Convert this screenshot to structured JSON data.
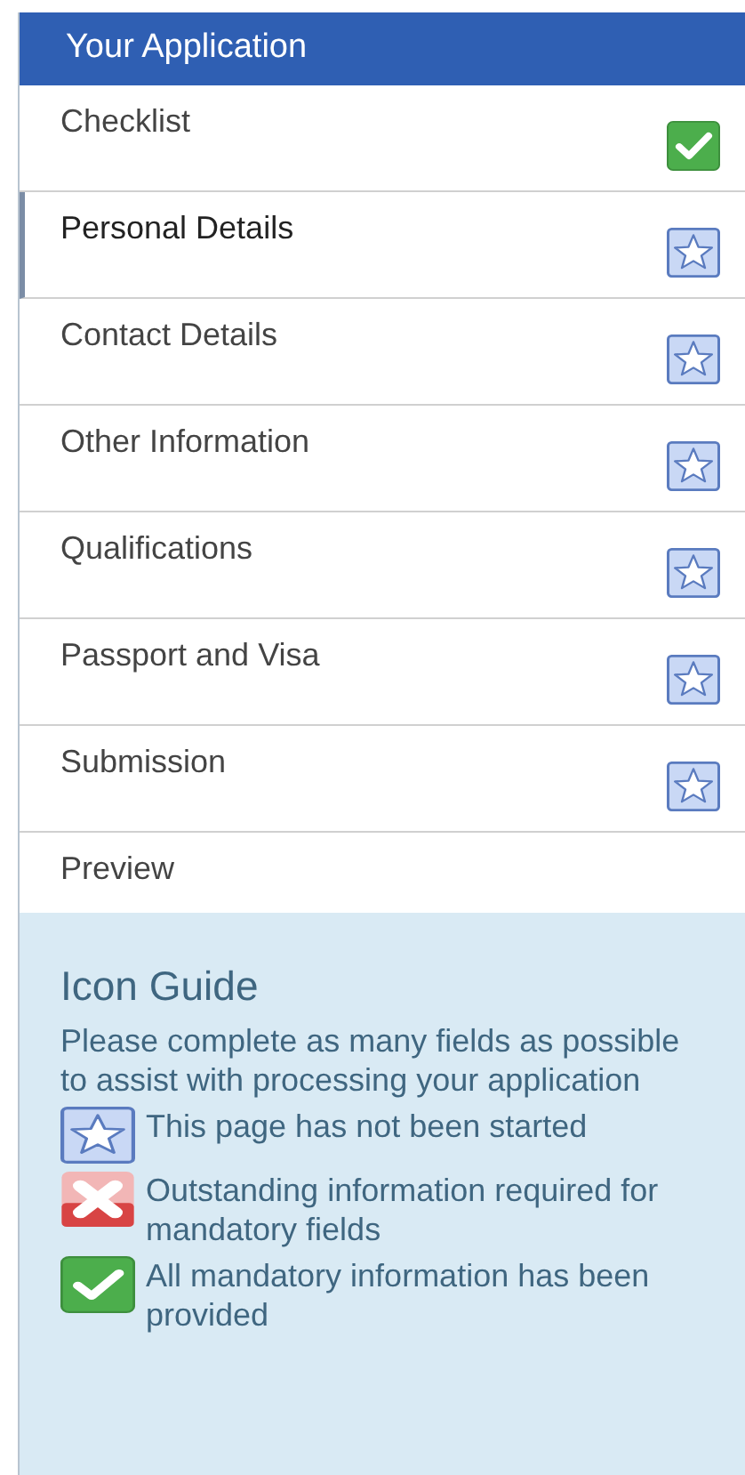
{
  "panel": {
    "title": "Your Application"
  },
  "items": [
    {
      "label": "Checklist",
      "kind": "complete",
      "selected": false
    },
    {
      "label": "Personal Details",
      "kind": "pending",
      "selected": true
    },
    {
      "label": "Contact Details",
      "kind": "pending",
      "selected": false
    },
    {
      "label": "Other Information",
      "kind": "pending",
      "selected": false
    },
    {
      "label": "Qualifications",
      "kind": "pending",
      "selected": false
    },
    {
      "label": "Passport and Visa",
      "kind": "pending",
      "selected": false
    },
    {
      "label": "Submission",
      "kind": "pending",
      "selected": false
    },
    {
      "label": "Preview",
      "kind": "plain",
      "selected": false
    }
  ],
  "icon_guide": {
    "title": "Icon Guide",
    "intro": "Please complete as many fields as possible to assist with processing your application",
    "legend": [
      {
        "kind": "pending",
        "text": "This page has not been started"
      },
      {
        "kind": "outstanding",
        "text": "Outstanding information required for mandatory fields"
      },
      {
        "kind": "complete",
        "text": "All mandatory information has been provided"
      }
    ]
  }
}
